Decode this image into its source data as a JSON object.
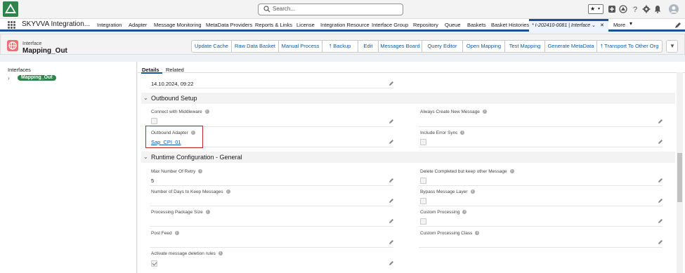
{
  "topbar": {
    "logo_text": "SKYVVA",
    "search_placeholder": "Search..."
  },
  "nav": {
    "app_name": "SKYVVA Integration...",
    "items": [
      "Integration",
      "Adapter",
      "Message Monitoring",
      "MetaData Providers",
      "Reports & Links",
      "License",
      "Integration Resource",
      "Interface Group",
      "Repository",
      "Queue",
      "Baskets",
      "Basket Histories"
    ],
    "active_tab": "* I-202410-0081 | Interface",
    "more": "More"
  },
  "header": {
    "object_type": "Interface",
    "record_name": "Mapping_Out",
    "buttons": [
      "Update Cache",
      "Raw Data Basket",
      "Manual Process",
      "Backup",
      "Edit",
      "Messages Board",
      "Query Editor",
      "Open Mapping",
      "Test Mapping",
      "Generate MetaData",
      "Transport To Other Org"
    ]
  },
  "left_panel": {
    "title": "Interfaces",
    "tree_item": "Mapping_Out"
  },
  "tabs": {
    "details": "Details",
    "related": "Related"
  },
  "fields": {
    "date_value": "14.10.2024, 09:22",
    "section_outbound": "Outbound Setup",
    "connect_middleware": "Connect with Middleware",
    "always_create": "Always Create New Message",
    "outbound_adapter": "Outbound Adapter",
    "outbound_adapter_value": "Sap_CPI_01",
    "include_error_sync": "Include Error Sync",
    "section_runtime": "Runtime Configuration - General",
    "max_retry": "Max Number Of Retry",
    "max_retry_value": "5",
    "delete_completed": "Delete Completed but keep other Message",
    "days_keep": "Number of Days to Keep Messages",
    "bypass_layer": "Bypass Message Layer",
    "package_size": "Processing Package Size",
    "custom_processing": "Custom Processing",
    "post_feed": "Post Feed",
    "custom_processing_class": "Custom Processing Class",
    "activate_deletion": "Activate message deletion rules"
  },
  "checkbox_states": {
    "connect_middleware": false,
    "always_create": false,
    "include_error_sync": false,
    "delete_completed": false,
    "bypass_layer": false,
    "custom_processing": false,
    "activate_deletion": true
  },
  "colors": {
    "brand_blue": "#1b5297",
    "link_blue": "#0b5cab",
    "pill_green": "#2e844a",
    "highlight_red": "#c0262d",
    "icon_pink": "#ea7174"
  }
}
